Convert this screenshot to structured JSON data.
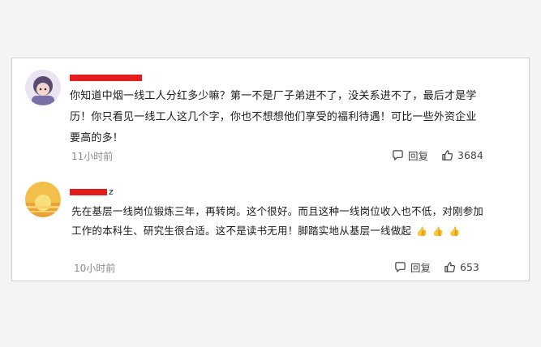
{
  "comments": [
    {
      "username": "",
      "text": "你知道中烟一线工人分红多少嘛？第一不是厂子弟进不了，没关系进不了，最后才是学历！你只看见一线工人这几个字，你也不想想他们享受的福利待遇！可比一些外资企业要高的多！",
      "time": "11小时前",
      "reply_label": "回复",
      "like_count": "3684"
    },
    {
      "username": "z",
      "text": "先在基层一线岗位锻炼三年，再转岗。这个很好。而且这种一线岗位收入也不低，对刚参加工作的本科生、研究生很合适。这不是读书无用！脚踏实地从基层一线做起",
      "emoji": [
        "👍",
        "👍",
        "👍"
      ],
      "time": "10小时前",
      "reply_label": "回复",
      "like_count": "653"
    }
  ],
  "colors": {
    "redaction": "#e31c1c",
    "time": "#8a8a8a"
  }
}
